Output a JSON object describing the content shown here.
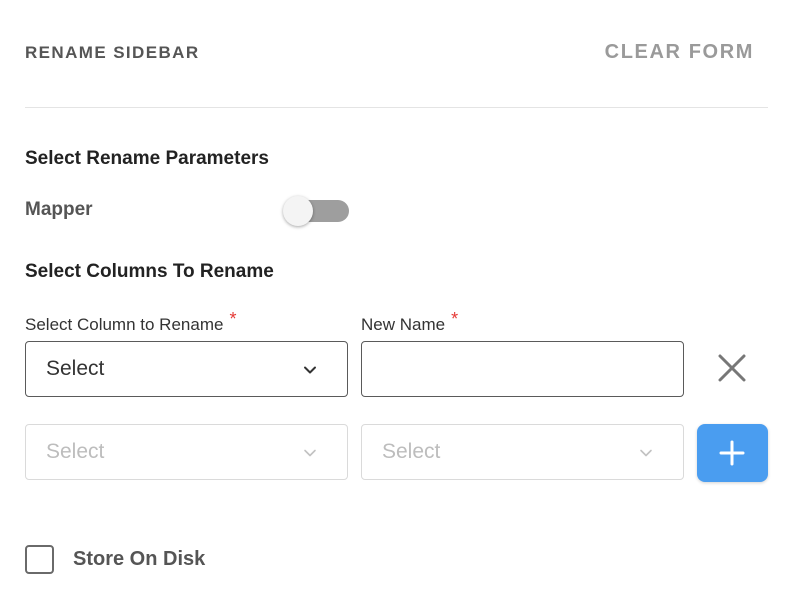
{
  "header": {
    "title": "RENAME SIDEBAR",
    "clear_label": "CLEAR FORM"
  },
  "parameters": {
    "section_title": "Select Rename Parameters",
    "mapper_label": "Mapper",
    "mapper_enabled": false
  },
  "columns": {
    "section_title": "Select Columns To Rename",
    "column_label": "Select Column to Rename",
    "new_name_label": "New Name",
    "required_mark": "*",
    "rows": [
      {
        "column_value": "Select",
        "new_name_value": ""
      },
      {
        "column_value": "Select",
        "new_name_value": "Select"
      }
    ]
  },
  "icons": {
    "remove": "close-icon",
    "add": "plus-icon",
    "dropdown": "chevron-down-icon"
  },
  "footer": {
    "store_label": "Store On Disk",
    "store_checked": false
  },
  "colors": {
    "accent": "#4a9df0",
    "required": "#e53935",
    "toggle_track": "#9e9e9e"
  }
}
